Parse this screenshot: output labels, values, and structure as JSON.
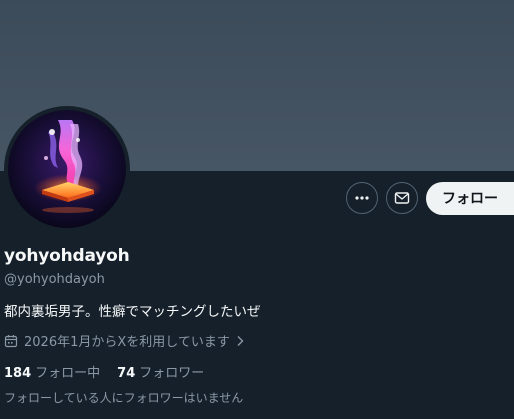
{
  "profile": {
    "display_name": "yohyohdayoh",
    "handle": "@yohyohdayoh",
    "bio": "都内裏垢男子。性癖でマッチングしたいぜ",
    "joined": "2026年1月からXを利用しています",
    "following_count": "184",
    "following_label": "フォロー中",
    "followers_count": "74",
    "followers_label": "フォロワー",
    "followers_you_know": "フォローしている人にフォロワーはいません"
  },
  "actions": {
    "more_icon": "more-horizontal-icon",
    "message_icon": "envelope-icon",
    "follow_label": "フォロー"
  },
  "colors": {
    "background": "#15202b",
    "banner": "#475664",
    "secondary_text": "#8b98a5",
    "button_bg": "#eff3f4"
  }
}
